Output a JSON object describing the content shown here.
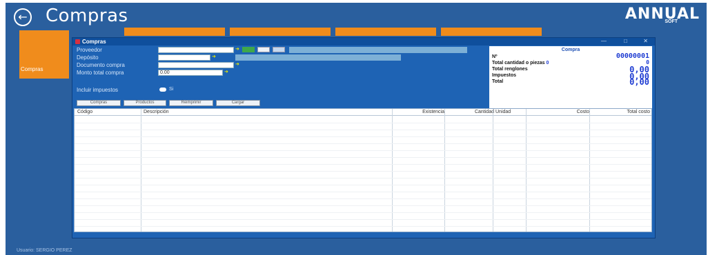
{
  "app": {
    "title": "Compras",
    "brand": "ANNUAL",
    "brand_sub": "SOFT",
    "side_tile_label": "Compras",
    "footer_user": "Usuario: SERGIO PEREZ"
  },
  "dialog": {
    "title": "Compras",
    "window_controls": [
      "—",
      "□",
      "✕"
    ],
    "form": {
      "proveedor_label": "Proveedor",
      "deposito_label": "Depósito",
      "documento_label": "Documento compra",
      "monto_label": "Monto total compra",
      "monto_value": "0.00",
      "incluir_label": "Incluir impuestos",
      "incluir_value": "Si"
    },
    "summary": {
      "header": "Compra",
      "number_label": "Nº",
      "number_value": "00000001",
      "cantidad_label": "Total cantidad o piezas",
      "cantidad_value": "0",
      "renglones_label": "Total renglones",
      "renglones_value": "0",
      "impuestos_label": "Impuestos",
      "impuestos_value": "0,00",
      "total_label": "Total",
      "total_value": "0,00"
    },
    "actions": [
      "Compras",
      "Productos",
      "Reimprimir",
      "Cargar"
    ],
    "grid": {
      "columns": [
        "Código",
        "Descripción",
        "Existencia",
        "Cantidad",
        "Unidad",
        "Costo",
        "Total costo"
      ]
    }
  },
  "colors": {
    "background": "#2a5f9e",
    "accent_orange": "#f08c1c",
    "dialog_blue": "#1e63b4",
    "value_blue": "#1e3cd2"
  },
  "icons": [
    "back-arrow-icon",
    "app-window-icon",
    "arrow-right-icon"
  ]
}
